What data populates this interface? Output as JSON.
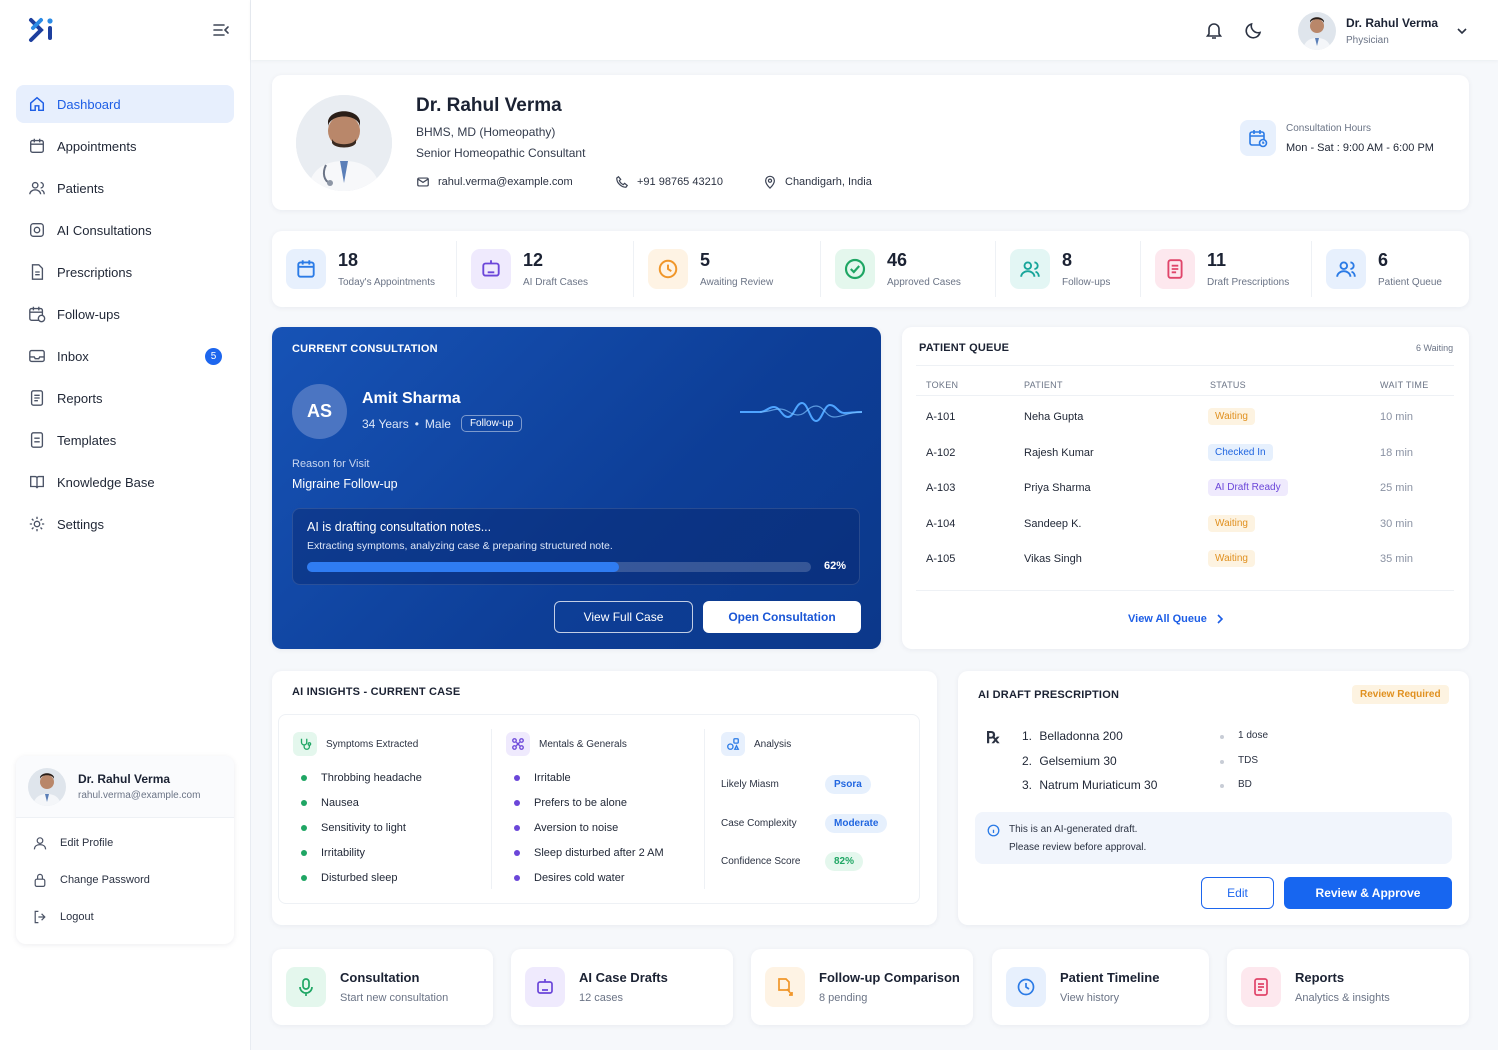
{
  "sidebar": {
    "items": [
      {
        "label": "Dashboard",
        "icon": "home-icon",
        "active": true
      },
      {
        "label": "Appointments",
        "icon": "calendar-icon"
      },
      {
        "label": "Patients",
        "icon": "users-icon"
      },
      {
        "label": "AI Consultations",
        "icon": "ai-chip-icon"
      },
      {
        "label": "Prescriptions",
        "icon": "prescription-icon"
      },
      {
        "label": "Follow-ups",
        "icon": "calendar-clock-icon"
      },
      {
        "label": "Inbox",
        "icon": "inbox-icon",
        "badge": "5"
      },
      {
        "label": "Reports",
        "icon": "report-icon"
      },
      {
        "label": "Templates",
        "icon": "template-icon"
      },
      {
        "label": "Knowledge Base",
        "icon": "book-icon"
      },
      {
        "label": "Settings",
        "icon": "gear-icon"
      }
    ],
    "user": {
      "name": "Dr. Rahul Verma",
      "email": "rahul.verma@example.com"
    },
    "menu": {
      "edit_profile": "Edit Profile",
      "change_password": "Change Password",
      "logout": "Logout"
    }
  },
  "topbar": {
    "user_name": "Dr. Rahul Verma",
    "user_role": "Physician"
  },
  "profile": {
    "name": "Dr. Rahul Verma",
    "degree": "BHMS, MD (Homeopathy)",
    "title": "Senior Homeopathic Consultant",
    "email": "rahul.verma@example.com",
    "phone": "+91 98765 43210",
    "location": "Chandigarh, India",
    "hours_label": "Consultation Hours",
    "hours_value": "Mon - Sat : 9:00 AM - 6:00 PM"
  },
  "stats": [
    {
      "value": "18",
      "label": "Today's Appointments",
      "color": "#2b7be6",
      "bg": "#e7f0fd"
    },
    {
      "value": "12",
      "label": "AI Draft Cases",
      "color": "#6b46d9",
      "bg": "#efeafd"
    },
    {
      "value": "5",
      "label": "Awaiting Review",
      "color": "#f0962a",
      "bg": "#fef3e4"
    },
    {
      "value": "46",
      "label": "Approved Cases",
      "color": "#1fa664",
      "bg": "#e4f7ed"
    },
    {
      "value": "8",
      "label": "Follow-ups",
      "color": "#18a59a",
      "bg": "#e3f6f4"
    },
    {
      "value": "11",
      "label": "Draft Prescriptions",
      "color": "#e0456a",
      "bg": "#fde8ee"
    },
    {
      "value": "6",
      "label": "Patient Queue",
      "color": "#2b7be6",
      "bg": "#e7f0fd"
    }
  ],
  "consultation": {
    "title": "CURRENT CONSULTATION",
    "initials": "AS",
    "patient": "Amit Sharma",
    "age": "34 Years",
    "gender": "Male",
    "tag": "Follow-up",
    "reason_label": "Reason for Visit",
    "reason": "Migraine Follow-up",
    "ai_title": "AI is drafting consultation notes...",
    "ai_desc": "Extracting symptoms, analyzing case & preparing structured note.",
    "progress": 0.62,
    "progress_label": "62%",
    "btn_view": "View Full Case",
    "btn_open": "Open Consultation"
  },
  "queue": {
    "title": "PATIENT QUEUE",
    "count": "6 Waiting",
    "headers": [
      "TOKEN",
      "PATIENT",
      "STATUS",
      "WAIT TIME"
    ],
    "rows": [
      {
        "token": "A-101",
        "patient": "Neha Gupta",
        "status": "Waiting",
        "kind": "wait",
        "wait": "10 min"
      },
      {
        "token": "A-102",
        "patient": "Rajesh Kumar",
        "status": "Checked In",
        "kind": "check",
        "wait": "18 min"
      },
      {
        "token": "A-103",
        "patient": "Priya Sharma",
        "status": "AI Draft Ready",
        "kind": "ai",
        "wait": "25 min"
      },
      {
        "token": "A-104",
        "patient": "Sandeep K.",
        "status": "Waiting",
        "kind": "wait",
        "wait": "30 min"
      },
      {
        "token": "A-105",
        "patient": "Vikas Singh",
        "status": "Waiting",
        "kind": "wait",
        "wait": "35 min"
      }
    ],
    "view_all": "View All Queue"
  },
  "insights": {
    "title": "AI INSIGHTS - CURRENT CASE",
    "symptoms_title": "Symptoms Extracted",
    "symptoms": [
      "Throbbing headache",
      "Nausea",
      "Sensitivity to light",
      "Irritability",
      "Disturbed sleep"
    ],
    "mentals_title": "Mentals & Generals",
    "mentals": [
      "Irritable",
      "Prefers to be alone",
      "Aversion to noise",
      "Sleep disturbed after 2 AM",
      "Desires cold water"
    ],
    "analysis_title": "Analysis",
    "analysis": [
      {
        "label": "Likely Miasm",
        "value": "Psora",
        "color": "#2166e0",
        "bg": "#e6f0fd"
      },
      {
        "label": "Case Complexity",
        "value": "Moderate",
        "color": "#2166e0",
        "bg": "#e6f0fd"
      },
      {
        "label": "Confidence Score",
        "value": "82%",
        "color": "#1fa664",
        "bg": "#e4f7ed"
      }
    ]
  },
  "prescription": {
    "title": "AI DRAFT PRESCRIPTION",
    "badge": "Review Required",
    "rx_symbol": "℞",
    "items": [
      {
        "num": "1.",
        "name": "Belladonna 200",
        "dose": "1 dose"
      },
      {
        "num": "2.",
        "name": "Gelsemium 30",
        "dose": "TDS"
      },
      {
        "num": "3.",
        "name": "Natrum Muriaticum 30",
        "dose": "BD"
      }
    ],
    "note_line1": "This is an AI-generated draft.",
    "note_line2": "Please review before approval.",
    "btn_edit": "Edit",
    "btn_approve": "Review & Approve"
  },
  "quick": [
    {
      "title": "Consultation",
      "sub": "Start new consultation",
      "color": "#1fa664",
      "bg": "#e4f7ed"
    },
    {
      "title": "AI Case Drafts",
      "sub": "12 cases",
      "color": "#6b46d9",
      "bg": "#efeafd"
    },
    {
      "title": "Follow-up Comparison",
      "sub": "8 pending",
      "color": "#f0962a",
      "bg": "#fef3e4"
    },
    {
      "title": "Patient Timeline",
      "sub": "View history",
      "color": "#2b7be6",
      "bg": "#e7f0fd"
    },
    {
      "title": "Reports",
      "sub": "Analytics & insights",
      "color": "#e0456a",
      "bg": "#fde8ee"
    }
  ]
}
